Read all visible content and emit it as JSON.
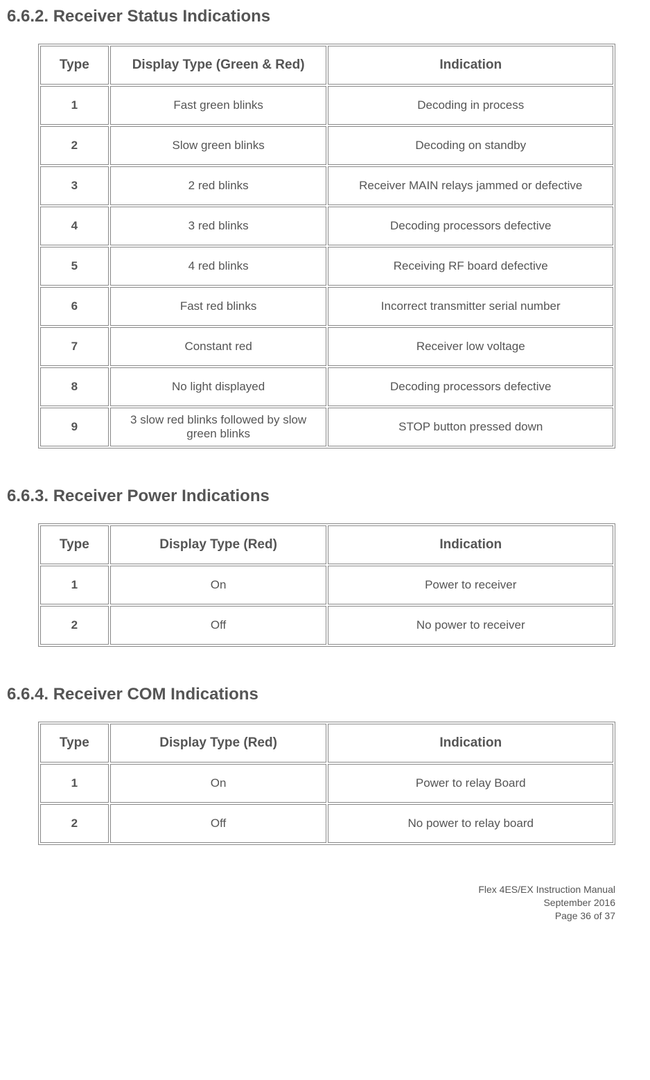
{
  "sections": [
    {
      "heading": "6.6.2. Receiver Status Indications",
      "columns": [
        "Type",
        "Display Type (Green & Red)",
        "Indication"
      ],
      "rows": [
        {
          "type": "1",
          "display": "Fast green blinks",
          "indication": "Decoding in process"
        },
        {
          "type": "2",
          "display": "Slow green blinks",
          "indication": "Decoding on standby"
        },
        {
          "type": "3",
          "display": "2 red blinks",
          "indication": "Receiver MAIN relays jammed or defective"
        },
        {
          "type": "4",
          "display": "3 red blinks",
          "indication": "Decoding processors defective"
        },
        {
          "type": "5",
          "display": "4 red blinks",
          "indication": "Receiving RF board defective"
        },
        {
          "type": "6",
          "display": "Fast red blinks",
          "indication": "Incorrect transmitter serial number"
        },
        {
          "type": "7",
          "display": "Constant red",
          "indication": "Receiver low voltage"
        },
        {
          "type": "8",
          "display": "No light displayed",
          "indication": "Decoding processors defective"
        },
        {
          "type": "9",
          "display": "3 slow red blinks followed by slow green blinks",
          "indication": "STOP button pressed down"
        }
      ]
    },
    {
      "heading": "6.6.3. Receiver Power Indications",
      "columns": [
        "Type",
        "Display Type (Red)",
        "Indication"
      ],
      "rows": [
        {
          "type": "1",
          "display": "On",
          "indication": "Power to receiver"
        },
        {
          "type": "2",
          "display": "Off",
          "indication": "No power to receiver"
        }
      ]
    },
    {
      "heading": "6.6.4. Receiver COM Indications",
      "columns": [
        "Type",
        "Display Type (Red)",
        "Indication"
      ],
      "rows": [
        {
          "type": "1",
          "display": "On",
          "indication": "Power to relay Board"
        },
        {
          "type": "2",
          "display": "Off",
          "indication": "No power to relay board"
        }
      ]
    }
  ],
  "footer": {
    "line1": "Flex 4ES/EX Instruction Manual",
    "line2": "September 2016",
    "line3": "Page 36 of 37"
  }
}
